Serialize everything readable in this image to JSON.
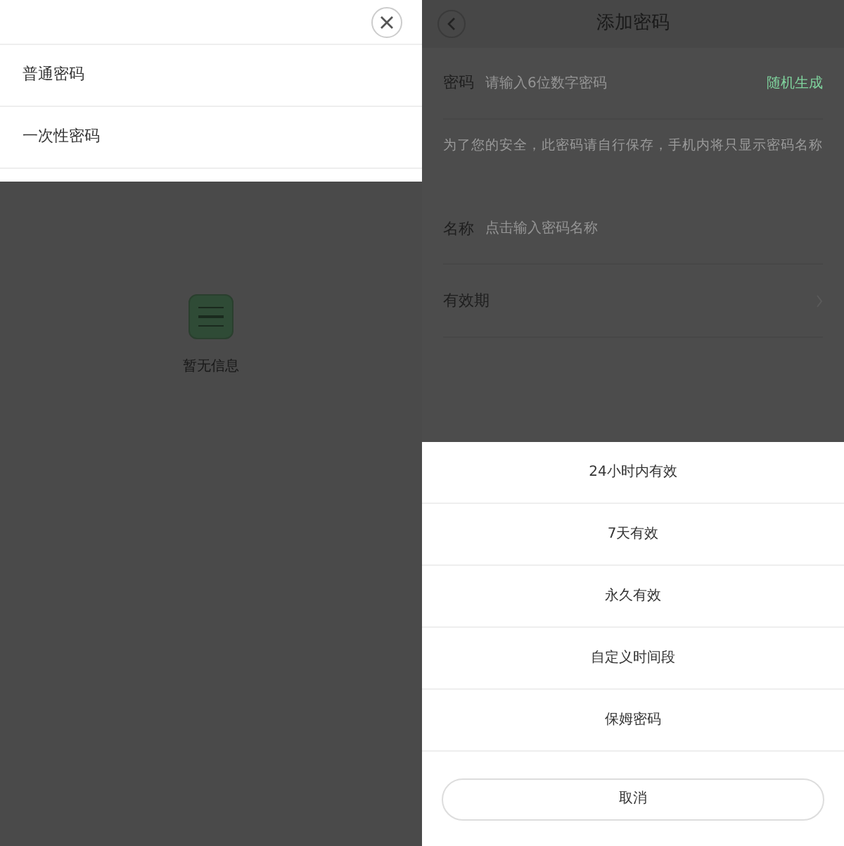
{
  "left_screen": {
    "sheet": {
      "options": [
        {
          "label": "普通密码"
        },
        {
          "label": "一次性密码"
        }
      ]
    },
    "empty_state": {
      "text": "暂无信息"
    }
  },
  "right_screen": {
    "header": {
      "title": "添加密码"
    },
    "password": {
      "label": "密码",
      "placeholder": "请输入6位数字密码",
      "action": "随机生成"
    },
    "hint": "为了您的安全，此密码请自行保存，手机内将只显示密码名称",
    "name": {
      "label": "名称",
      "placeholder": "点击输入密码名称"
    },
    "validity": {
      "label": "有效期"
    },
    "action_sheet": {
      "options": [
        {
          "label": "24小时内有效"
        },
        {
          "label": "7天有效"
        },
        {
          "label": "永久有效"
        },
        {
          "label": "自定义时间段"
        },
        {
          "label": "保姆密码"
        }
      ],
      "cancel": "取消"
    }
  }
}
